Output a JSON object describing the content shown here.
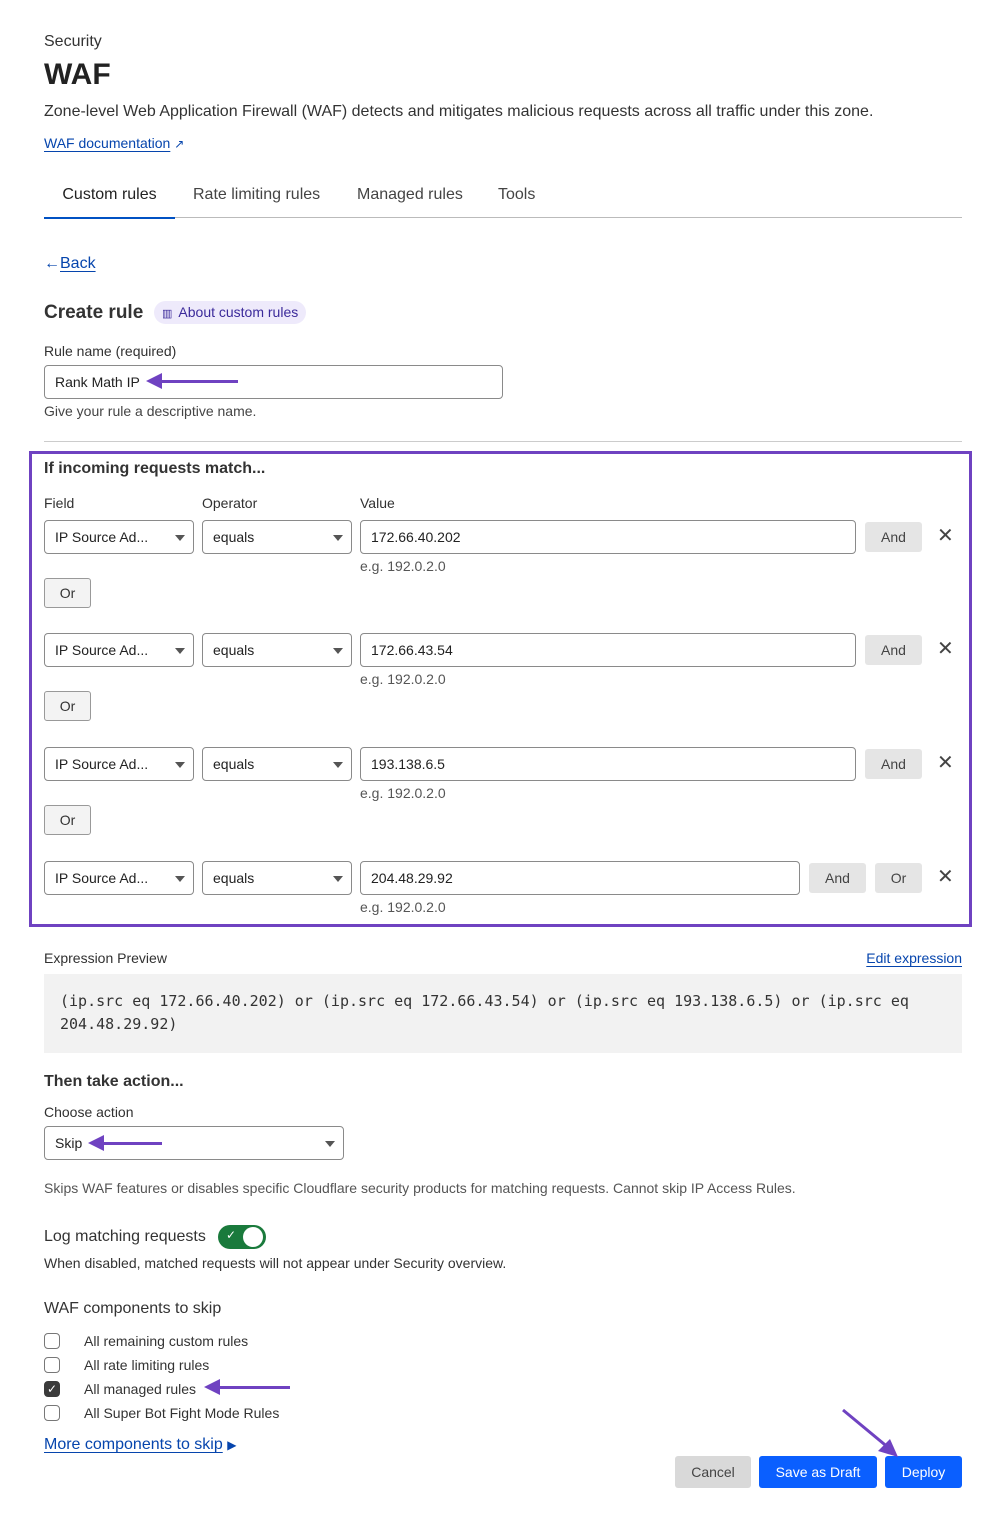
{
  "header": {
    "section": "Security",
    "title": "WAF",
    "description": "Zone-level Web Application Firewall (WAF) detects and mitigates malicious requests across all traffic under this zone.",
    "doc_link": "WAF documentation"
  },
  "tabs": [
    {
      "label": "Custom rules",
      "active": true
    },
    {
      "label": "Rate limiting rules"
    },
    {
      "label": "Managed rules"
    },
    {
      "label": "Tools"
    }
  ],
  "back": "Back",
  "create": {
    "title": "Create rule",
    "about": "About custom rules",
    "name_label": "Rule name (required)",
    "name_value": "Rank Math IP",
    "name_help": "Give your rule a descriptive name."
  },
  "match": {
    "title": "If incoming requests match...",
    "col_field": "Field",
    "col_operator": "Operator",
    "col_value": "Value",
    "and_label": "And",
    "or_label": "Or",
    "rows": [
      {
        "field": "IP Source Ad...",
        "operator": "equals",
        "value": "172.66.40.202",
        "hint": "e.g. 192.0.2.0"
      },
      {
        "field": "IP Source Ad...",
        "operator": "equals",
        "value": "172.66.43.54",
        "hint": "e.g. 192.0.2.0"
      },
      {
        "field": "IP Source Ad...",
        "operator": "equals",
        "value": "193.138.6.5",
        "hint": "e.g. 192.0.2.0"
      },
      {
        "field": "IP Source Ad...",
        "operator": "equals",
        "value": "204.48.29.92",
        "hint": "e.g. 192.0.2.0"
      }
    ]
  },
  "expression": {
    "label": "Expression Preview",
    "edit": "Edit expression",
    "text": "(ip.src eq 172.66.40.202) or (ip.src eq 172.66.43.54) or (ip.src eq 193.138.6.5) or (ip.src eq 204.48.29.92)"
  },
  "action": {
    "title": "Then take action...",
    "label": "Choose action",
    "value": "Skip",
    "help": "Skips WAF features or disables specific Cloudflare security products for matching requests. Cannot skip IP Access Rules."
  },
  "log": {
    "label": "Log matching requests",
    "enabled": true,
    "help": "When disabled, matched requests will not appear under Security overview."
  },
  "skip": {
    "title": "WAF components to skip",
    "items": [
      {
        "label": "All remaining custom rules",
        "checked": false
      },
      {
        "label": "All rate limiting rules",
        "checked": false
      },
      {
        "label": "All managed rules",
        "checked": true
      },
      {
        "label": "All Super Bot Fight Mode Rules",
        "checked": false
      }
    ],
    "more": "More components to skip"
  },
  "footer": {
    "cancel": "Cancel",
    "draft": "Save as Draft",
    "deploy": "Deploy"
  },
  "colors": {
    "accent": "#0051c3",
    "annotation": "#6f42c1",
    "toggle": "#1a7a3c"
  }
}
